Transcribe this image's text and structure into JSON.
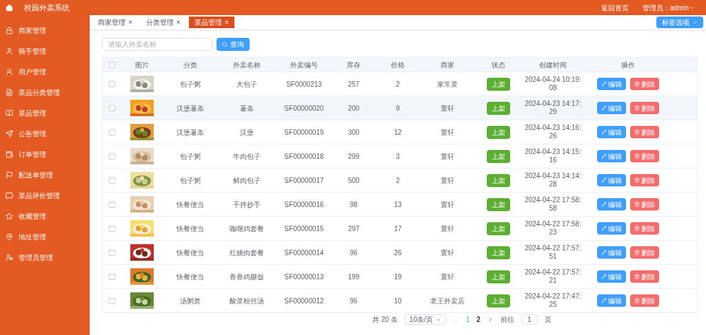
{
  "header": {
    "title": "校园外卖系统",
    "home_link": "返回首页",
    "user": "管理员：admin"
  },
  "sidebar": {
    "items": [
      {
        "label": "商家管理"
      },
      {
        "label": "骑手管理"
      },
      {
        "label": "用户管理"
      },
      {
        "label": "菜品分类管理"
      },
      {
        "label": "菜品管理"
      },
      {
        "label": "公告管理"
      },
      {
        "label": "订单管理"
      },
      {
        "label": "配送单管理"
      },
      {
        "label": "菜品评价管理"
      },
      {
        "label": "收藏管理"
      },
      {
        "label": "地址管理"
      },
      {
        "label": "管理员管理"
      }
    ]
  },
  "tabs": [
    {
      "label": "商家管理",
      "close": "×",
      "selected": false
    },
    {
      "label": "分类管理",
      "close": "×",
      "selected": false
    },
    {
      "label": "菜品管理",
      "close": "×",
      "selected": true
    }
  ],
  "tab_options": "标签选项",
  "search": {
    "placeholder": "请输入外卖名称",
    "button": "查询"
  },
  "table": {
    "all_checked": false,
    "columns": [
      "图片",
      "分类",
      "外卖名称",
      "外卖编号",
      "库存",
      "价格",
      "商家",
      "状态",
      "创建时间",
      "操作"
    ],
    "rows": [
      {
        "checked": false,
        "category": "包子粥",
        "name": "大包子",
        "code": "SF0000213",
        "stock": "257",
        "price": "2",
        "shop": "家常菜",
        "status": "上架",
        "created": "2024-04-24 10:19:08",
        "edit": "编辑",
        "delete": "删除",
        "selected": false
      },
      {
        "checked": false,
        "category": "汉堡薯条",
        "name": "薯条",
        "code": "SF00000020",
        "stock": "200",
        "price": "9",
        "shop": "寰轩",
        "status": "上架",
        "created": "2024-04-23 14:17:29",
        "edit": "编辑",
        "delete": "删除",
        "selected": true
      },
      {
        "checked": false,
        "category": "汉堡薯条",
        "name": "汉堡",
        "code": "SF00000019",
        "stock": "300",
        "price": "12",
        "shop": "寰轩",
        "status": "上架",
        "created": "2024-04-23 14:16:26",
        "edit": "编辑",
        "delete": "删除",
        "selected": false
      },
      {
        "checked": false,
        "category": "包子粥",
        "name": "牛肉包子",
        "code": "SF00000018",
        "stock": "299",
        "price": "3",
        "shop": "寰轩",
        "status": "上架",
        "created": "2024-04-23 14:15:16",
        "edit": "编辑",
        "delete": "删除",
        "selected": false
      },
      {
        "checked": false,
        "category": "包子粥",
        "name": "鲜肉包子",
        "code": "SF00000017",
        "stock": "500",
        "price": "2",
        "shop": "寰轩",
        "status": "上架",
        "created": "2024-04-23 14:14:28",
        "edit": "编辑",
        "delete": "删除",
        "selected": false
      },
      {
        "checked": false,
        "category": "快餐便当",
        "name": "干拌抄手",
        "code": "SF00000016",
        "stock": "98",
        "price": "13",
        "shop": "寰轩",
        "status": "上架",
        "created": "2024-04-22 17:58:58",
        "edit": "编辑",
        "delete": "删除",
        "selected": false
      },
      {
        "checked": false,
        "category": "快餐便当",
        "name": "咖喱鸡套餐",
        "code": "SF00000015",
        "stock": "297",
        "price": "17",
        "shop": "寰轩",
        "status": "上架",
        "created": "2024-04-22 17:58:23",
        "edit": "编辑",
        "delete": "删除",
        "selected": false
      },
      {
        "checked": false,
        "category": "快餐便当",
        "name": "红烧肉套餐",
        "code": "SF00000014",
        "stock": "96",
        "price": "26",
        "shop": "寰轩",
        "status": "上架",
        "created": "2024-04-22 17:57:51",
        "edit": "编辑",
        "delete": "删除",
        "selected": false
      },
      {
        "checked": false,
        "category": "快餐便当",
        "name": "香香鸡腿饭",
        "code": "SF00000013",
        "stock": "199",
        "price": "19",
        "shop": "寰轩",
        "status": "上架",
        "created": "2024-04-22 17:57:21",
        "edit": "编辑",
        "delete": "删除",
        "selected": false
      },
      {
        "checked": false,
        "category": "汤粥类",
        "name": "酸菜粉丝汤",
        "code": "SF00000012",
        "stock": "96",
        "price": "10",
        "shop": "老王外卖店",
        "status": "上架",
        "created": "2024-04-22 17:47:25",
        "edit": "编辑",
        "delete": "删除",
        "selected": false
      }
    ]
  },
  "pagination": {
    "total": "共 20 条",
    "page_size": "10条/页",
    "pages": [
      {
        "label": "1",
        "selected": true
      },
      {
        "label": "2",
        "selected": false
      }
    ],
    "goto": "前往",
    "goto_value": "1",
    "page_unit": "页"
  }
}
